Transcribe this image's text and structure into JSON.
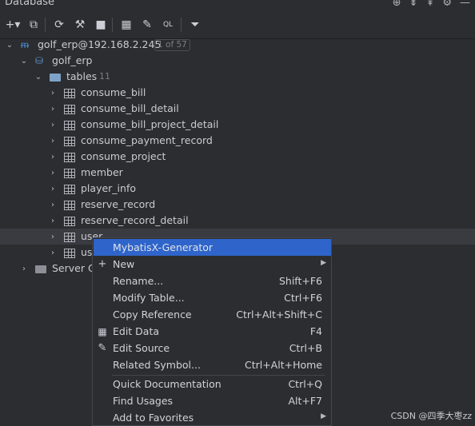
{
  "header": {
    "title": "Database"
  },
  "toolbar": {
    "buttons": [
      "add-icon",
      "copy-icon",
      "refresh-icon",
      "settings-wrench-icon",
      "stop-icon",
      "table-icon",
      "edit-icon",
      "console-icon",
      "filter-icon"
    ]
  },
  "tree": {
    "connection": {
      "label": "golf_erp@192.168.2.245",
      "badge": "1 of 57"
    },
    "schema": "golf_erp",
    "tables_folder": {
      "label": "tables",
      "count": "11"
    },
    "tables": [
      "consume_bill",
      "consume_bill_detail",
      "consume_bill_project_detail",
      "consume_payment_record",
      "consume_project",
      "member",
      "player_info",
      "reserve_record",
      "reserve_record_detail",
      "user",
      "us"
    ],
    "server_objects": "Server O"
  },
  "context_menu": {
    "items": [
      {
        "label": "MybatisX-Generator",
        "shortcut": ""
      },
      {
        "label": "New",
        "shortcut": ""
      },
      {
        "label": "Rename...",
        "shortcut": "Shift+F6"
      },
      {
        "label": "Modify Table...",
        "shortcut": "Ctrl+F6"
      },
      {
        "label": "Copy Reference",
        "shortcut": "Ctrl+Alt+Shift+C"
      },
      {
        "label": "Edit Data",
        "shortcut": "F4"
      },
      {
        "label": "Edit Source",
        "shortcut": "Ctrl+B"
      },
      {
        "label": "Related Symbol...",
        "shortcut": "Ctrl+Alt+Home"
      },
      {
        "label": "Quick Documentation",
        "shortcut": "Ctrl+Q"
      },
      {
        "label": "Find Usages",
        "shortcut": "Alt+F7"
      },
      {
        "label": "Add to Favorites",
        "shortcut": ""
      }
    ]
  },
  "watermark": "CSDN @四季大枣zz"
}
